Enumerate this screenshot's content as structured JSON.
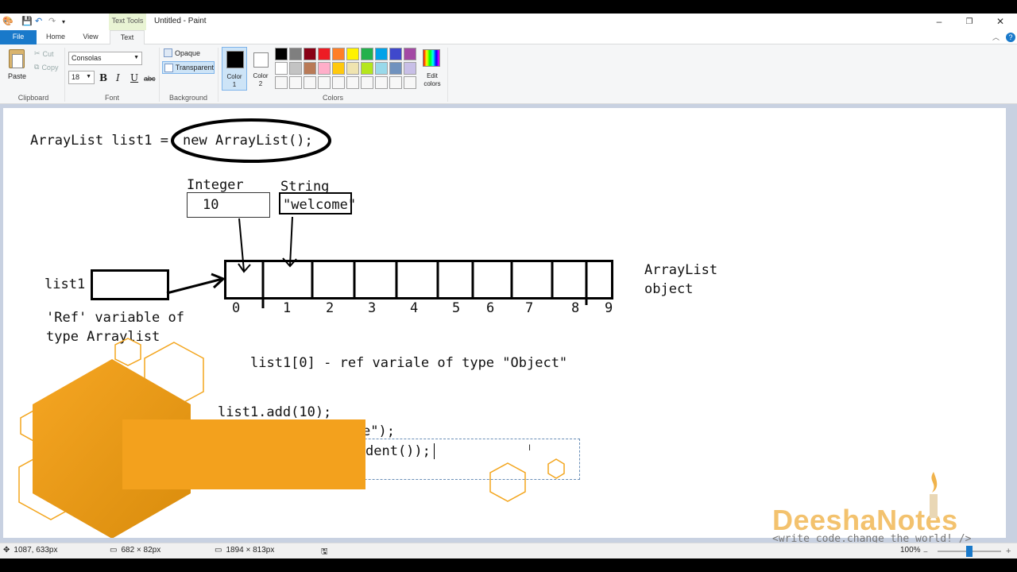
{
  "window": {
    "contextual_tab": "Text Tools",
    "title": "Untitled - Paint",
    "minimize": "–",
    "maximize": "❐",
    "close": "✕"
  },
  "tabs": [
    {
      "label": "File"
    },
    {
      "label": "Home"
    },
    {
      "label": "View"
    },
    {
      "label": "Text"
    }
  ],
  "clipboard": {
    "paste": "Paste",
    "cut": "Cut",
    "copy": "Copy",
    "group": "Clipboard"
  },
  "font": {
    "family": "Consolas",
    "size": "18",
    "bold": "B",
    "italic": "I",
    "underline": "U",
    "strike": "abc",
    "group": "Font"
  },
  "background": {
    "opaque": "Opaque",
    "transparent": "Transparent",
    "group": "Background"
  },
  "colors": {
    "color1": "Color\n1",
    "color1_a": "Color",
    "color1_b": "1",
    "color2_a": "Color",
    "color2_b": "2",
    "edit_a": "Edit",
    "edit_b": "colors",
    "group": "Colors",
    "color1_value": "#000000",
    "color2_value": "#ffffff",
    "palette_row1": [
      "#000000",
      "#7f7f7f",
      "#880015",
      "#ed1c24",
      "#ff7f27",
      "#fff200",
      "#22b14c",
      "#00a2e8",
      "#3f48cc",
      "#a349a4"
    ],
    "palette_row2": [
      "#ffffff",
      "#c3c3c3",
      "#b97a57",
      "#ffaec9",
      "#ffc90e",
      "#efe4b0",
      "#b5e61d",
      "#99d9ea",
      "#7092be",
      "#c8bfe7"
    ]
  },
  "canvas": {
    "line1_left": "ArrayList list1 = ",
    "line1_circled": "new ArrayList();",
    "integer_label": "Integer",
    "integer_value": "10",
    "string_label": "String",
    "string_value": "\"welcome\"",
    "list1_label": "list1",
    "ref_line1": "'Ref' variable of",
    "ref_line2": "type Arraylist",
    "indices": [
      "0",
      "1",
      "2",
      "3",
      "4",
      "5",
      "6",
      "7",
      "8",
      "9"
    ],
    "object_line1": "ArrayList",
    "object_line2": "object",
    "ref_desc": "list1[0] - ref variale of type \"Object\"",
    "code1": "list1.add(10);",
    "code2": "e\");",
    "code3": "dent());",
    "watermark_brand": "DeeshaNotes",
    "watermark_tagline": "<write code.change the world! />"
  },
  "status": {
    "cursor": "1087, 633px",
    "selection": "682 × 82px",
    "canvas_size": "1894 × 813px",
    "zoom": "100%"
  }
}
